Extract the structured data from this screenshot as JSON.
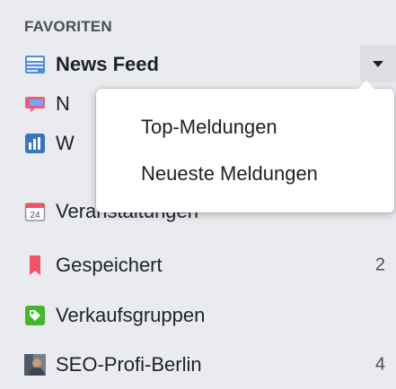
{
  "section": {
    "title": "FAVORITEN"
  },
  "items": [
    {
      "label": "News Feed",
      "icon": "news-feed-icon",
      "count": ""
    },
    {
      "label": "N",
      "icon": "messages-icon",
      "count": ""
    },
    {
      "label": "W",
      "icon": "pages-feed-icon",
      "count": ""
    },
    {
      "label": "Veranstaltungen",
      "icon": "events-calendar-icon",
      "count": ""
    },
    {
      "label": "Gespeichert",
      "icon": "saved-bookmark-icon",
      "count": "2"
    },
    {
      "label": "Verkaufsgruppen",
      "icon": "sale-tag-icon",
      "count": ""
    },
    {
      "label": "SEO-Profi-Berlin",
      "icon": "group-avatar-icon",
      "count": "4"
    }
  ],
  "calendar_day": "24",
  "dropdown": {
    "options": [
      "Top-Meldungen",
      "Neueste Meldungen"
    ]
  },
  "colors": {
    "background": "#e9ebee",
    "text": "#1d2129",
    "header": "#4b4f56",
    "messages_icon": "#f25c7a",
    "pages_icon": "#3b73c4",
    "saved_icon": "#f25268",
    "sale_icon": "#42b72a"
  }
}
